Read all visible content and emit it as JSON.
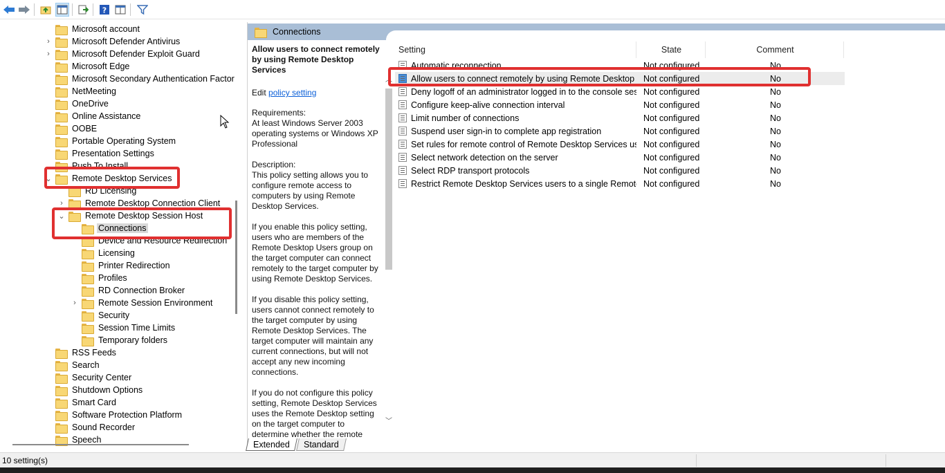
{
  "tree": {
    "items": [
      {
        "label": "Microsoft account",
        "indent": 0,
        "expander": ""
      },
      {
        "label": "Microsoft Defender Antivirus",
        "indent": 0,
        "expander": "›"
      },
      {
        "label": "Microsoft Defender Exploit Guard",
        "indent": 0,
        "expander": "›"
      },
      {
        "label": "Microsoft Edge",
        "indent": 0,
        "expander": ""
      },
      {
        "label": "Microsoft Secondary Authentication Factor",
        "indent": 0,
        "expander": ""
      },
      {
        "label": "NetMeeting",
        "indent": 0,
        "expander": ""
      },
      {
        "label": "OneDrive",
        "indent": 0,
        "expander": ""
      },
      {
        "label": "Online Assistance",
        "indent": 0,
        "expander": ""
      },
      {
        "label": "OOBE",
        "indent": 0,
        "expander": ""
      },
      {
        "label": "Portable Operating System",
        "indent": 0,
        "expander": ""
      },
      {
        "label": "Presentation Settings",
        "indent": 0,
        "expander": ""
      },
      {
        "label": "Push To Install",
        "indent": 0,
        "expander": ""
      },
      {
        "label": "Remote Desktop Services",
        "indent": 0,
        "expander": "⌄"
      },
      {
        "label": "RD Licensing",
        "indent": 1,
        "expander": ""
      },
      {
        "label": "Remote Desktop Connection Client",
        "indent": 1,
        "expander": "›"
      },
      {
        "label": "Remote Desktop Session Host",
        "indent": 1,
        "expander": "⌄"
      },
      {
        "label": "Connections",
        "indent": 2,
        "expander": "",
        "selected": true
      },
      {
        "label": "Device and Resource Redirection",
        "indent": 2,
        "expander": ""
      },
      {
        "label": "Licensing",
        "indent": 2,
        "expander": ""
      },
      {
        "label": "Printer Redirection",
        "indent": 2,
        "expander": ""
      },
      {
        "label": "Profiles",
        "indent": 2,
        "expander": ""
      },
      {
        "label": "RD Connection Broker",
        "indent": 2,
        "expander": ""
      },
      {
        "label": "Remote Session Environment",
        "indent": 2,
        "expander": "›"
      },
      {
        "label": "Security",
        "indent": 2,
        "expander": ""
      },
      {
        "label": "Session Time Limits",
        "indent": 2,
        "expander": ""
      },
      {
        "label": "Temporary folders",
        "indent": 2,
        "expander": ""
      },
      {
        "label": "RSS Feeds",
        "indent": 0,
        "expander": ""
      },
      {
        "label": "Search",
        "indent": 0,
        "expander": ""
      },
      {
        "label": "Security Center",
        "indent": 0,
        "expander": ""
      },
      {
        "label": "Shutdown Options",
        "indent": 0,
        "expander": ""
      },
      {
        "label": "Smart Card",
        "indent": 0,
        "expander": ""
      },
      {
        "label": "Software Protection Platform",
        "indent": 0,
        "expander": ""
      },
      {
        "label": "Sound Recorder",
        "indent": 0,
        "expander": ""
      },
      {
        "label": "Speech",
        "indent": 0,
        "expander": ""
      }
    ]
  },
  "right": {
    "header_title": "Connections",
    "description": {
      "title": "Allow users to connect remotely by using Remote Desktop Services",
      "edit_prefix": "Edit",
      "edit_link": "policy setting",
      "requirements": "Requirements:\nAt least Windows Server 2003 operating systems or Windows XP Professional",
      "paragraphs": [
        "Description:\nThis policy setting allows you to configure remote access to computers by using Remote Desktop Services.",
        "If you enable this policy setting, users who are members of the Remote Desktop Users group on the target computer can connect remotely to the target computer by using Remote Desktop Services.",
        "If you disable this policy setting, users cannot connect remotely to the target computer by using Remote Desktop Services. The target computer will maintain any current connections, but will not accept any new incoming connections.",
        "If you do not configure this policy setting, Remote Desktop Services uses the Remote Desktop setting on the target computer to determine whether the remote connection is allowed. This setting"
      ]
    },
    "columns": {
      "setting": "Setting",
      "state": "State",
      "comment": "Comment"
    },
    "rows": [
      {
        "setting": "Automatic reconnection",
        "state": "Not configured",
        "comment": "No"
      },
      {
        "setting": "Allow users to connect remotely by using Remote Desktop S...",
        "state": "Not configured",
        "comment": "No",
        "selected": true
      },
      {
        "setting": "Deny logoff of an administrator logged in to the console ses...",
        "state": "Not configured",
        "comment": "No"
      },
      {
        "setting": "Configure keep-alive connection interval",
        "state": "Not configured",
        "comment": "No"
      },
      {
        "setting": "Limit number of connections",
        "state": "Not configured",
        "comment": "No"
      },
      {
        "setting": "Suspend user sign-in to complete app registration",
        "state": "Not configured",
        "comment": "No"
      },
      {
        "setting": "Set rules for remote control of Remote Desktop Services use...",
        "state": "Not configured",
        "comment": "No"
      },
      {
        "setting": "Select network detection on the server",
        "state": "Not configured",
        "comment": "No"
      },
      {
        "setting": "Select RDP transport protocols",
        "state": "Not configured",
        "comment": "No"
      },
      {
        "setting": "Restrict Remote Desktop Services users to a single Remote D...",
        "state": "Not configured",
        "comment": "No"
      }
    ]
  },
  "tabs": {
    "extended": "Extended",
    "standard": "Standard"
  },
  "status": {
    "text": "10 setting(s)"
  }
}
